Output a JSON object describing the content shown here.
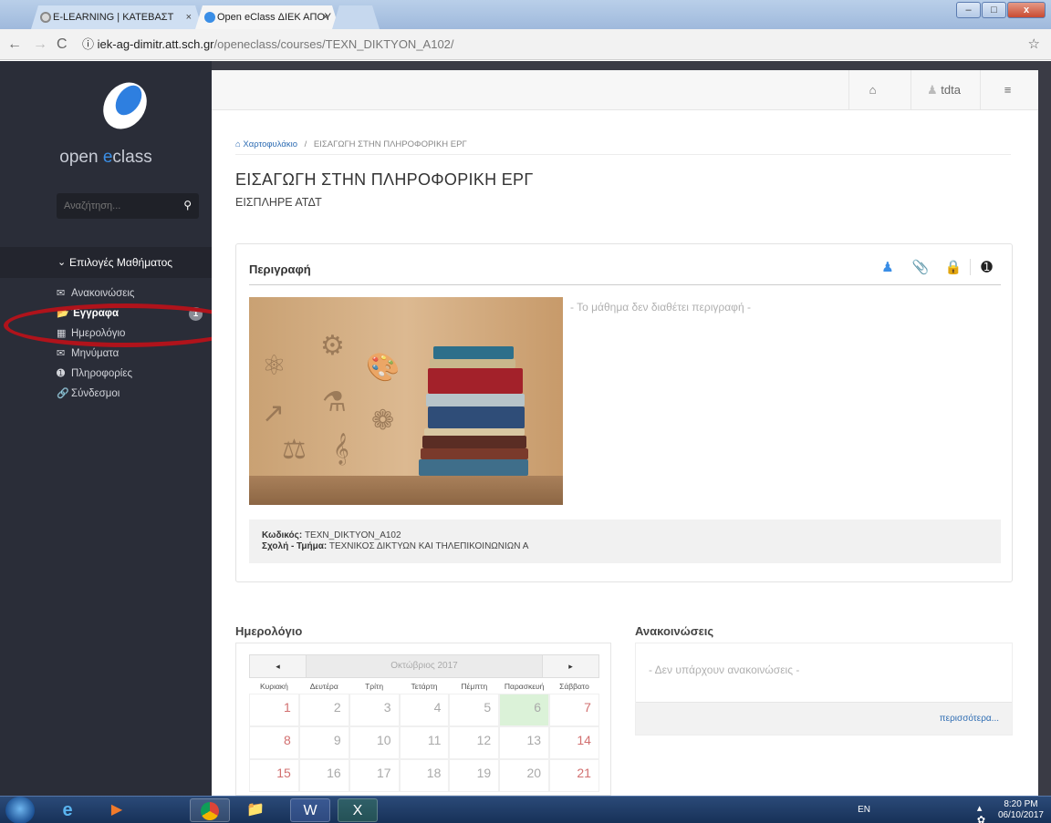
{
  "browser": {
    "tabs": [
      {
        "label": "E-LEARNING | ΚΑΤΕΒΑΣΤ",
        "close": "×"
      },
      {
        "label": "Open eClass ΔΙΕΚ ΑΠΟΥ",
        "close": "×"
      }
    ],
    "window_buttons": [
      "–",
      "□",
      "x"
    ],
    "url_host": "iek-ag-dimitr.att.sch.gr",
    "url_path": "/openeclass/courses/TEXN_DIKTYON_A102/",
    "url_info": "ⓘ"
  },
  "sidebar": {
    "logo_text_1": "open ",
    "logo_text_2": "e",
    "logo_text_3": "class",
    "search_placeholder": "Αναζήτηση...",
    "menu_title": "Επιλογές Μαθήματος",
    "items": [
      {
        "label": "Ανακοινώσεις",
        "icon": "megaphone-icon"
      },
      {
        "label": "Έγγραφα",
        "icon": "folder-open-icon",
        "badge": "1",
        "active": true
      },
      {
        "label": "Ημερολόγιο",
        "icon": "calendar-icon"
      },
      {
        "label": "Μηνύματα",
        "icon": "envelope-icon"
      },
      {
        "label": "Πληροφορίες",
        "icon": "info-circle-icon"
      },
      {
        "label": "Σύνδεσμοι",
        "icon": "link-icon"
      }
    ]
  },
  "topbar": {
    "user": "tdta"
  },
  "breadcrumb": {
    "home": "Χαρτοφυλάκιο",
    "sep": "/",
    "current": "ΕΙΣΑΓΩΓΗ ΣΤΗΝ ΠΛΗΡΟΦΟΡΙΚΗ ΕΡΓ"
  },
  "course": {
    "title": "ΕΙΣΑΓΩΓΗ ΣΤΗΝ ΠΛΗΡΟΦΟΡΙΚΗ ΕΡΓ",
    "subtitle": "ΕΙΣΠΛΗΡΕ ΑΤΔΤ",
    "description_heading": "Περιγραφή",
    "no_description": "- Το μάθημα δεν διαθέτει περιγραφή -",
    "code_label": "Κωδικός:",
    "code_value": "TEXN_DIKTYON_A102",
    "dept_label": "Σχολή - Τμήμα:",
    "dept_value": "ΤΕΧΝΙΚΟΣ ΔΙΚΤΥΩΝ ΚΑΙ ΤΗΛΕΠΙΚΟΙΝΩΝΙΩΝ Α"
  },
  "calendar": {
    "heading": "Ημερολόγιο",
    "prev": "◂",
    "next": "▸",
    "month": "Οκτώβριος 2017",
    "weekdays": [
      "Κυριακή",
      "Δευτέρα",
      "Τρίτη",
      "Τετάρτη",
      "Πέμπτη",
      "Παρασκευή",
      "Σάββατο"
    ],
    "rows": [
      [
        "1",
        "2",
        "3",
        "4",
        "5",
        "6",
        "7"
      ],
      [
        "8",
        "9",
        "10",
        "11",
        "12",
        "13",
        "14"
      ],
      [
        "15",
        "16",
        "17",
        "18",
        "19",
        "20",
        "21"
      ]
    ],
    "today": "6"
  },
  "announcements": {
    "heading": "Ανακοινώσεις",
    "empty": "- Δεν υπάρχουν ανακοινώσεις -",
    "more": "περισσότερα..."
  },
  "taskbar": {
    "lang": "EN",
    "time": "8:20 PM",
    "date": "06/10/2017"
  },
  "colors": {
    "sidebar": "#2a2d38",
    "accent": "#3a8ee6",
    "highlight_ellipse": "#b0131b",
    "today": "#dbf2d8"
  }
}
